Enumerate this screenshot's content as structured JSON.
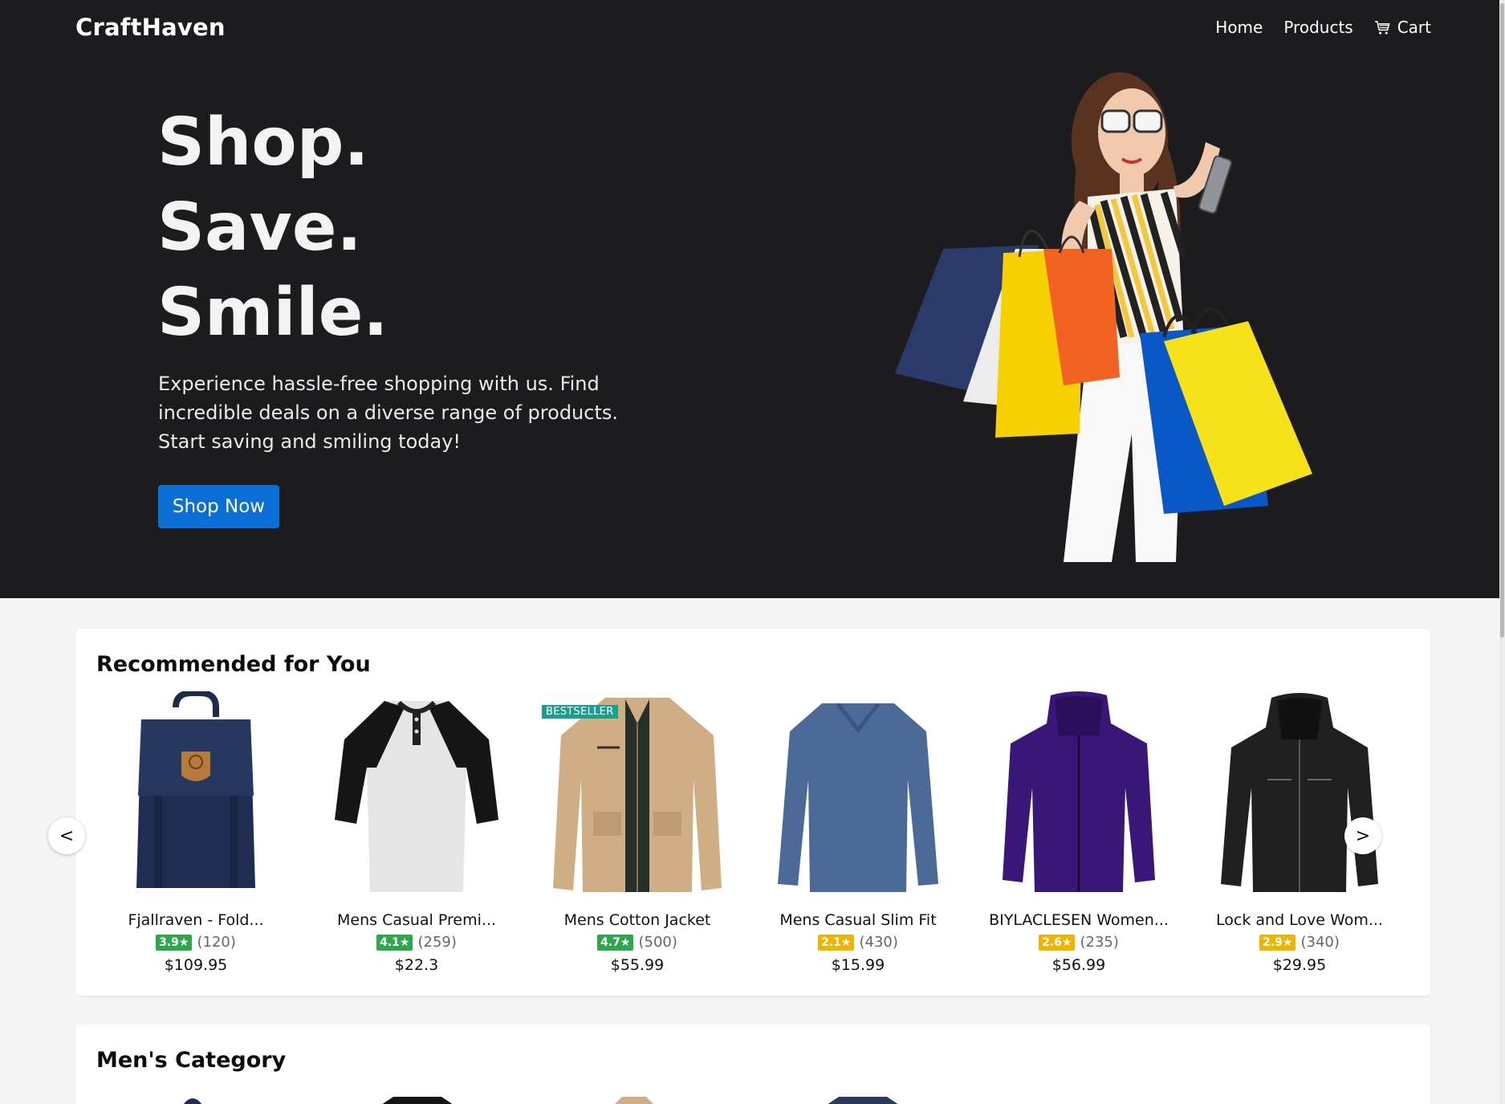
{
  "nav": {
    "brand": "CraftHaven",
    "links": [
      "Home",
      "Products"
    ],
    "cart_label": "Cart"
  },
  "hero": {
    "lines": [
      "Shop.",
      "Save.",
      "Smile."
    ],
    "subtext": "Experience hassle-free shopping with us. Find incredible deals on a diverse range of products. Start saving and smiling today!",
    "cta": "Shop Now"
  },
  "recommended": {
    "title": "Recommended for You",
    "prev": "<",
    "next": ">",
    "products": [
      {
        "name": "Fjallraven - Fold...",
        "rating": "3.9★",
        "reviews": "(120)",
        "price": "$109.95",
        "badge_color": "#2aa84a"
      },
      {
        "name": "Mens Casual Premi...",
        "rating": "4.1★",
        "reviews": "(259)",
        "price": "$22.3",
        "badge_color": "#2aa84a"
      },
      {
        "name": "Mens Cotton Jacket",
        "rating": "4.7★",
        "reviews": "(500)",
        "price": "$55.99",
        "badge_color": "#2aa84a",
        "tag": "BESTSELLER"
      },
      {
        "name": "Mens Casual Slim Fit",
        "rating": "2.1★",
        "reviews": "(430)",
        "price": "$15.99",
        "badge_color": "#f0b400"
      },
      {
        "name": "BIYLACLESEN Women...",
        "rating": "2.6★",
        "reviews": "(235)",
        "price": "$56.99",
        "badge_color": "#f0b400"
      },
      {
        "name": "Lock and Love Wom...",
        "rating": "2.9★",
        "reviews": "(340)",
        "price": "$29.95",
        "badge_color": "#f0b400"
      }
    ]
  },
  "mens": {
    "title": "Men's Category"
  },
  "colors": {
    "hero_bg": "#1c1c1e",
    "accent": "#0a6fd6",
    "good_rating": "#2aa84a",
    "low_rating": "#f0b400",
    "bestseller": "#1a9e8f"
  }
}
